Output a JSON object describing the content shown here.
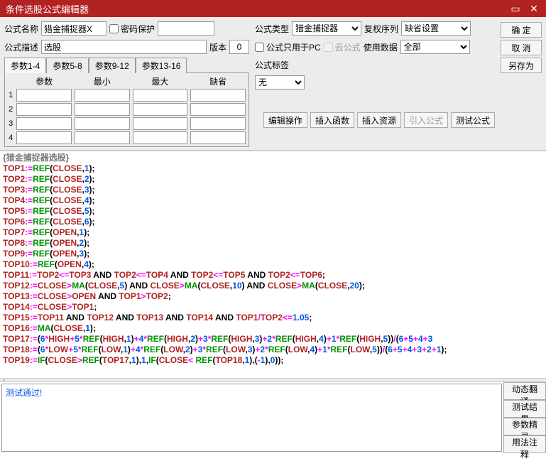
{
  "title": "条件选股公式编辑器",
  "labels": {
    "name": "公式名称",
    "desc": "公式描述",
    "version": "版本",
    "pwdprotect": "密码保护",
    "type": "公式类型",
    "rightseq": "复权序列",
    "pconly": "公式只用于PC",
    "cloud": "云公式",
    "usedata": "使用数据",
    "tag": "公式标签"
  },
  "values": {
    "name": "猎金捕捉器X",
    "desc": "选股",
    "version": "0",
    "type": "猎金捕捉器",
    "rightseq": "缺省设置",
    "usedata": "全部",
    "tag": "无"
  },
  "tabs": {
    "t1": "参数1-4",
    "t2": "参数5-8",
    "t3": "参数9-12",
    "t4": "参数13-16"
  },
  "paramHeaders": {
    "p": "参数",
    "min": "最小",
    "max": "最大",
    "def": "缺省"
  },
  "paramRows": [
    "1",
    "2",
    "3",
    "4"
  ],
  "buttons": {
    "ok": "确 定",
    "cancel": "取 消",
    "saveas": "另存为",
    "editop": "编辑操作",
    "insertfn": "插入函数",
    "insertres": "插入资源",
    "importf": "引入公式",
    "testf": "测试公式",
    "dyntrans": "动态翻译",
    "testres": "测试结果",
    "paramwiz": "参数精灵",
    "usage": "用法注释"
  },
  "codeHeader": "{猎金捕捉器选股}",
  "resultText": "测试通过!",
  "codeLines": [
    [
      [
        "id",
        "TOP1"
      ],
      [
        "op",
        ":="
      ],
      [
        "fn",
        "REF"
      ],
      [
        "punc",
        "("
      ],
      [
        "id",
        "CLOSE"
      ],
      [
        "punc",
        ","
      ],
      [
        "num",
        "1"
      ],
      [
        "punc",
        ");"
      ]
    ],
    [
      [
        "id",
        "TOP2"
      ],
      [
        "op",
        ":="
      ],
      [
        "fn",
        "REF"
      ],
      [
        "punc",
        "("
      ],
      [
        "id",
        "CLOSE"
      ],
      [
        "punc",
        ","
      ],
      [
        "num",
        "2"
      ],
      [
        "punc",
        ");"
      ]
    ],
    [
      [
        "id",
        "TOP3"
      ],
      [
        "op",
        ":="
      ],
      [
        "fn",
        "REF"
      ],
      [
        "punc",
        "("
      ],
      [
        "id",
        "CLOSE"
      ],
      [
        "punc",
        ","
      ],
      [
        "num",
        "3"
      ],
      [
        "punc",
        ");"
      ]
    ],
    [
      [
        "id",
        "TOP4"
      ],
      [
        "op",
        ":="
      ],
      [
        "fn",
        "REF"
      ],
      [
        "punc",
        "("
      ],
      [
        "id",
        "CLOSE"
      ],
      [
        "punc",
        ","
      ],
      [
        "num",
        "4"
      ],
      [
        "punc",
        ");"
      ]
    ],
    [
      [
        "id",
        "TOP5"
      ],
      [
        "op",
        ":="
      ],
      [
        "fn",
        "REF"
      ],
      [
        "punc",
        "("
      ],
      [
        "id",
        "CLOSE"
      ],
      [
        "punc",
        ","
      ],
      [
        "num",
        "5"
      ],
      [
        "punc",
        ");"
      ]
    ],
    [
      [
        "id",
        "TOP6"
      ],
      [
        "op",
        ":="
      ],
      [
        "fn",
        "REF"
      ],
      [
        "punc",
        "("
      ],
      [
        "id",
        "CLOSE"
      ],
      [
        "punc",
        ","
      ],
      [
        "num",
        "6"
      ],
      [
        "punc",
        ");"
      ]
    ],
    [
      [
        "id",
        "TOP7"
      ],
      [
        "op",
        ":="
      ],
      [
        "fn",
        "REF"
      ],
      [
        "punc",
        "("
      ],
      [
        "id",
        "OPEN"
      ],
      [
        "punc",
        ","
      ],
      [
        "num",
        "1"
      ],
      [
        "punc",
        ");"
      ]
    ],
    [
      [
        "id",
        "TOP8"
      ],
      [
        "op",
        ":="
      ],
      [
        "fn",
        "REF"
      ],
      [
        "punc",
        "("
      ],
      [
        "id",
        "OPEN"
      ],
      [
        "punc",
        ","
      ],
      [
        "num",
        "2"
      ],
      [
        "punc",
        ");"
      ]
    ],
    [
      [
        "id",
        "TOP9"
      ],
      [
        "op",
        ":="
      ],
      [
        "fn",
        "REF"
      ],
      [
        "punc",
        "("
      ],
      [
        "id",
        "OPEN"
      ],
      [
        "punc",
        ","
      ],
      [
        "num",
        "3"
      ],
      [
        "punc",
        ");"
      ]
    ],
    [
      [
        "id",
        "TOP10"
      ],
      [
        "op",
        ":="
      ],
      [
        "fn",
        "REF"
      ],
      [
        "punc",
        "("
      ],
      [
        "id",
        "OPEN"
      ],
      [
        "punc",
        ","
      ],
      [
        "num",
        "4"
      ],
      [
        "punc",
        ");"
      ]
    ],
    [
      [
        "id",
        "TOP11"
      ],
      [
        "op",
        ":="
      ],
      [
        "id",
        "TOP2"
      ],
      [
        "op",
        "<="
      ],
      [
        "id",
        "TOP3"
      ],
      [
        "kw",
        " AND "
      ],
      [
        "id",
        "TOP2"
      ],
      [
        "op",
        "<="
      ],
      [
        "id",
        "TOP4"
      ],
      [
        "kw",
        " AND "
      ],
      [
        "id",
        "TOP2"
      ],
      [
        "op",
        "<="
      ],
      [
        "id",
        "TOP5"
      ],
      [
        "kw",
        " AND "
      ],
      [
        "id",
        "TOP2"
      ],
      [
        "op",
        "<="
      ],
      [
        "id",
        "TOP6"
      ],
      [
        "punc",
        ";"
      ]
    ],
    [
      [
        "id",
        "TOP12"
      ],
      [
        "op",
        ":="
      ],
      [
        "id",
        "CLOSE"
      ],
      [
        "op",
        ">"
      ],
      [
        "fn",
        "MA"
      ],
      [
        "punc",
        "("
      ],
      [
        "id",
        "CLOSE"
      ],
      [
        "punc",
        ","
      ],
      [
        "num",
        "5"
      ],
      [
        "punc",
        ")"
      ],
      [
        "kw",
        " AND "
      ],
      [
        "id",
        "CLOSE"
      ],
      [
        "op",
        ">"
      ],
      [
        "fn",
        "MA"
      ],
      [
        "punc",
        "("
      ],
      [
        "id",
        "CLOSE"
      ],
      [
        "punc",
        ","
      ],
      [
        "num",
        "10"
      ],
      [
        "punc",
        ")"
      ],
      [
        "kw",
        " AND "
      ],
      [
        "id",
        "CLOSE"
      ],
      [
        "op",
        ">"
      ],
      [
        "fn",
        "MA"
      ],
      [
        "punc",
        "("
      ],
      [
        "id",
        "CLOSE"
      ],
      [
        "punc",
        ","
      ],
      [
        "num",
        "20"
      ],
      [
        "punc",
        ");"
      ]
    ],
    [
      [
        "id",
        "TOP13"
      ],
      [
        "op",
        ":="
      ],
      [
        "id",
        "CLOSE"
      ],
      [
        "op",
        ">"
      ],
      [
        "id",
        "OPEN"
      ],
      [
        "kw",
        " AND "
      ],
      [
        "id",
        "TOP1"
      ],
      [
        "op",
        ">"
      ],
      [
        "id",
        "TOP2"
      ],
      [
        "punc",
        ";"
      ]
    ],
    [
      [
        "id",
        "TOP14"
      ],
      [
        "op",
        ":="
      ],
      [
        "id",
        "CLOSE"
      ],
      [
        "op",
        ">"
      ],
      [
        "id",
        "TOP1"
      ],
      [
        "punc",
        ";"
      ]
    ],
    [
      [
        "id",
        "TOP15"
      ],
      [
        "op",
        ":="
      ],
      [
        "id",
        "TOP11"
      ],
      [
        "kw",
        " AND "
      ],
      [
        "id",
        "TOP12"
      ],
      [
        "kw",
        " AND "
      ],
      [
        "id",
        "TOP13"
      ],
      [
        "kw",
        " AND "
      ],
      [
        "id",
        "TOP14"
      ],
      [
        "kw",
        " AND "
      ],
      [
        "id",
        "TOP1"
      ],
      [
        "op",
        "/"
      ],
      [
        "id",
        "TOP2"
      ],
      [
        "op",
        "<="
      ],
      [
        "num",
        "1.05"
      ],
      [
        "punc",
        ";"
      ]
    ],
    [
      [
        "id",
        "TOP16"
      ],
      [
        "op",
        ":="
      ],
      [
        "fn",
        "MA"
      ],
      [
        "punc",
        "("
      ],
      [
        "id",
        "CLOSE"
      ],
      [
        "punc",
        ","
      ],
      [
        "num",
        "1"
      ],
      [
        "punc",
        ");"
      ]
    ],
    [
      [
        "id",
        "TOP17"
      ],
      [
        "op",
        ":="
      ],
      [
        "punc",
        "("
      ],
      [
        "num",
        "6"
      ],
      [
        "op",
        "*"
      ],
      [
        "id",
        "HIGH"
      ],
      [
        "op",
        "+"
      ],
      [
        "num",
        "5"
      ],
      [
        "op",
        "*"
      ],
      [
        "fn",
        "REF"
      ],
      [
        "punc",
        "("
      ],
      [
        "id",
        "HIGH"
      ],
      [
        "punc",
        ","
      ],
      [
        "num",
        "1"
      ],
      [
        "punc",
        ")"
      ],
      [
        "op",
        "+"
      ],
      [
        "num",
        "4"
      ],
      [
        "op",
        "*"
      ],
      [
        "fn",
        "REF"
      ],
      [
        "punc",
        "("
      ],
      [
        "id",
        "HIGH"
      ],
      [
        "punc",
        ","
      ],
      [
        "num",
        "2"
      ],
      [
        "punc",
        ")"
      ],
      [
        "op",
        "+"
      ],
      [
        "num",
        "3"
      ],
      [
        "op",
        "*"
      ],
      [
        "fn",
        "REF"
      ],
      [
        "punc",
        "("
      ],
      [
        "id",
        "HIGH"
      ],
      [
        "punc",
        ","
      ],
      [
        "num",
        "3"
      ],
      [
        "punc",
        ")"
      ],
      [
        "op",
        "+"
      ],
      [
        "num",
        "2"
      ],
      [
        "op",
        "*"
      ],
      [
        "fn",
        "REF"
      ],
      [
        "punc",
        "("
      ],
      [
        "id",
        "HIGH"
      ],
      [
        "punc",
        ","
      ],
      [
        "num",
        "4"
      ],
      [
        "punc",
        ")"
      ],
      [
        "op",
        "+"
      ],
      [
        "num",
        "1"
      ],
      [
        "op",
        "*"
      ],
      [
        "fn",
        "REF"
      ],
      [
        "punc",
        "("
      ],
      [
        "id",
        "HIGH"
      ],
      [
        "punc",
        ","
      ],
      [
        "num",
        "5"
      ],
      [
        "punc",
        "))"
      ],
      [
        "op",
        "/"
      ],
      [
        "punc",
        "("
      ],
      [
        "num",
        "6"
      ],
      [
        "op",
        "+"
      ],
      [
        "num",
        "5"
      ],
      [
        "op",
        "+"
      ],
      [
        "num",
        "4"
      ],
      [
        "op",
        "+"
      ],
      [
        "num",
        "3"
      ]
    ],
    [
      [
        "id",
        "TOP18"
      ],
      [
        "op",
        ":="
      ],
      [
        "punc",
        "("
      ],
      [
        "num",
        "6"
      ],
      [
        "op",
        "*"
      ],
      [
        "id",
        "LOW"
      ],
      [
        "op",
        "+"
      ],
      [
        "num",
        "5"
      ],
      [
        "op",
        "*"
      ],
      [
        "fn",
        "REF"
      ],
      [
        "punc",
        "("
      ],
      [
        "id",
        "LOW"
      ],
      [
        "punc",
        ","
      ],
      [
        "num",
        "1"
      ],
      [
        "punc",
        ")"
      ],
      [
        "op",
        "+"
      ],
      [
        "num",
        "4"
      ],
      [
        "op",
        "*"
      ],
      [
        "fn",
        "REF"
      ],
      [
        "punc",
        "("
      ],
      [
        "id",
        "LOW"
      ],
      [
        "punc",
        ","
      ],
      [
        "num",
        "2"
      ],
      [
        "punc",
        ")"
      ],
      [
        "op",
        "+"
      ],
      [
        "num",
        "3"
      ],
      [
        "op",
        "*"
      ],
      [
        "fn",
        "REF"
      ],
      [
        "punc",
        "("
      ],
      [
        "id",
        "LOW"
      ],
      [
        "punc",
        ","
      ],
      [
        "num",
        "3"
      ],
      [
        "punc",
        ")"
      ],
      [
        "op",
        "+"
      ],
      [
        "num",
        "2"
      ],
      [
        "op",
        "*"
      ],
      [
        "fn",
        "REF"
      ],
      [
        "punc",
        "("
      ],
      [
        "id",
        "LOW"
      ],
      [
        "punc",
        ","
      ],
      [
        "num",
        "4"
      ],
      [
        "punc",
        ")"
      ],
      [
        "op",
        "+"
      ],
      [
        "num",
        "1"
      ],
      [
        "op",
        "*"
      ],
      [
        "fn",
        "REF"
      ],
      [
        "punc",
        "("
      ],
      [
        "id",
        "LOW"
      ],
      [
        "punc",
        ","
      ],
      [
        "num",
        "5"
      ],
      [
        "punc",
        "))"
      ],
      [
        "op",
        "/"
      ],
      [
        "punc",
        "("
      ],
      [
        "num",
        "6"
      ],
      [
        "op",
        "+"
      ],
      [
        "num",
        "5"
      ],
      [
        "op",
        "+"
      ],
      [
        "num",
        "4"
      ],
      [
        "op",
        "+"
      ],
      [
        "num",
        "3"
      ],
      [
        "op",
        "+"
      ],
      [
        "num",
        "2"
      ],
      [
        "op",
        "+"
      ],
      [
        "num",
        "1"
      ],
      [
        "punc",
        ");"
      ]
    ],
    [
      [
        "id",
        "TOP19"
      ],
      [
        "op",
        ":="
      ],
      [
        "fn",
        "IF"
      ],
      [
        "punc",
        "("
      ],
      [
        "id",
        "CLOSE"
      ],
      [
        "op",
        ">"
      ],
      [
        "fn",
        "REF"
      ],
      [
        "punc",
        "("
      ],
      [
        "id",
        "TOP17"
      ],
      [
        "punc",
        ","
      ],
      [
        "num",
        "1"
      ],
      [
        "punc",
        ")"
      ],
      [
        "punc",
        ","
      ],
      [
        "num",
        "1"
      ],
      [
        "punc",
        ","
      ],
      [
        "fn",
        "IF"
      ],
      [
        "punc",
        "("
      ],
      [
        "id",
        "CLOSE"
      ],
      [
        "op",
        "<"
      ],
      [
        "fn",
        " REF"
      ],
      [
        "punc",
        "("
      ],
      [
        "id",
        "TOP18"
      ],
      [
        "punc",
        ","
      ],
      [
        "num",
        "1"
      ],
      [
        "punc",
        ")"
      ],
      [
        "punc",
        ",("
      ],
      [
        "op",
        "-"
      ],
      [
        "num",
        "1"
      ],
      [
        "punc",
        "),"
      ],
      [
        "num",
        "0"
      ],
      [
        "punc",
        "));"
      ]
    ]
  ]
}
